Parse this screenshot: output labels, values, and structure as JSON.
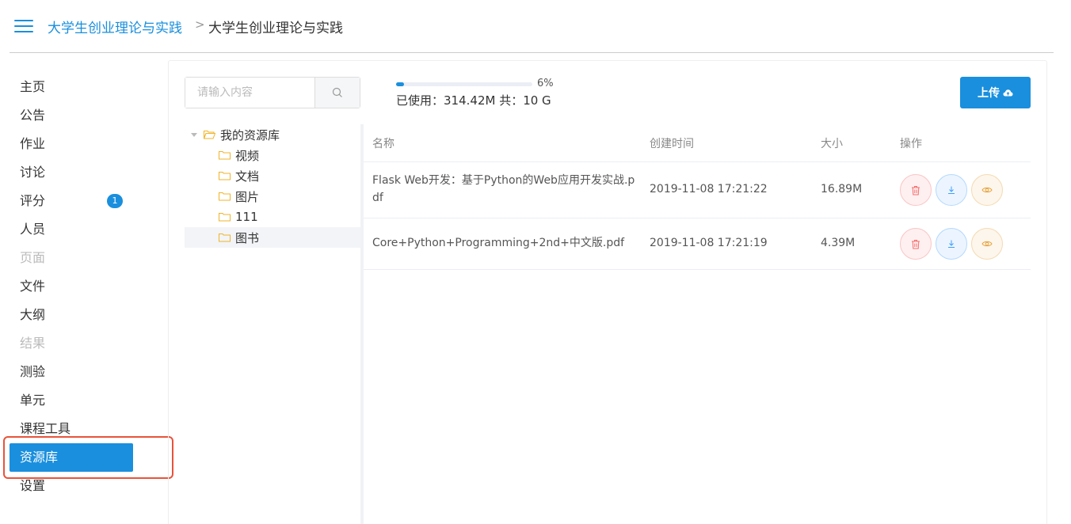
{
  "header": {
    "course_link": "大学生创业理论与实践",
    "separator": ">",
    "current": "大学生创业理论与实践"
  },
  "sidebar": {
    "items": [
      {
        "label": "主页",
        "state": "normal"
      },
      {
        "label": "公告",
        "state": "normal"
      },
      {
        "label": "作业",
        "state": "normal"
      },
      {
        "label": "讨论",
        "state": "normal"
      },
      {
        "label": "评分",
        "state": "normal",
        "badge": "1"
      },
      {
        "label": "人员",
        "state": "normal"
      },
      {
        "label": "页面",
        "state": "disabled"
      },
      {
        "label": "文件",
        "state": "normal"
      },
      {
        "label": "大纲",
        "state": "normal"
      },
      {
        "label": "结果",
        "state": "disabled"
      },
      {
        "label": "测验",
        "state": "normal"
      },
      {
        "label": "单元",
        "state": "normal"
      },
      {
        "label": "课程工具",
        "state": "normal"
      },
      {
        "label": "资源库",
        "state": "active"
      },
      {
        "label": "设置",
        "state": "normal"
      }
    ]
  },
  "search": {
    "placeholder": "请输入内容",
    "value": "",
    "icon": "search-icon"
  },
  "storage": {
    "percent": 6,
    "percent_label": "6%",
    "usage_text": "已使用：314.42M 共：10 G"
  },
  "upload": {
    "label": "上传",
    "icon": "cloud-upload-icon"
  },
  "tree": {
    "root": "我的资源库",
    "children": [
      "视频",
      "文档",
      "图片",
      "111",
      "图书"
    ],
    "selected": "图书"
  },
  "table": {
    "columns": [
      "名称",
      "创建时间",
      "大小",
      "操作"
    ],
    "rows": [
      {
        "name": "Flask Web开发：基于Python的Web应用开发实战.pdf",
        "created": "2019-11-08 17:21:22",
        "size": "16.89M"
      },
      {
        "name": "Core+Python+Programming+2nd+中文版.pdf",
        "created": "2019-11-08 17:21:19",
        "size": "4.39M"
      }
    ],
    "actions": [
      "delete-icon",
      "download-icon",
      "view-icon"
    ]
  },
  "colors": {
    "accent": "#1a8fdd",
    "highlight": "#e8533a",
    "delete": "#f56c6c",
    "download": "#409eff",
    "view": "#e6a23c"
  }
}
